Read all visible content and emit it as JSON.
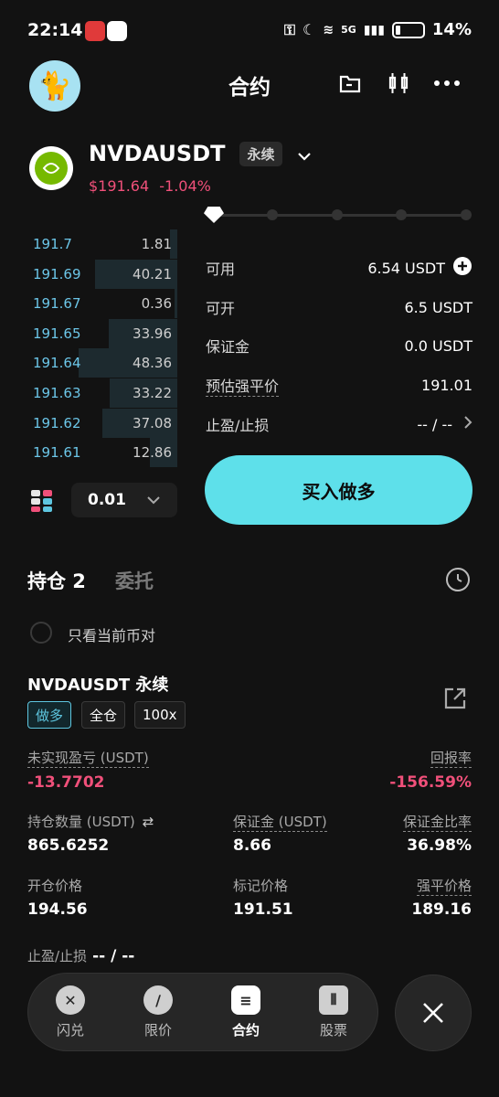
{
  "status_bar": {
    "time": "22:14",
    "battery": "14%",
    "network": "5G"
  },
  "header": {
    "title": "合约"
  },
  "symbol": {
    "name": "NVDAUSDT",
    "tag": "永续",
    "price": "$191.64",
    "change": "-1.04%"
  },
  "orderbook": {
    "rows": [
      {
        "price": "191.7",
        "amount": "1.81",
        "depth": 0.05
      },
      {
        "price": "191.69",
        "amount": "40.21",
        "depth": 0.55
      },
      {
        "price": "191.67",
        "amount": "0.36",
        "depth": 0.02
      },
      {
        "price": "191.65",
        "amount": "33.96",
        "depth": 0.46
      },
      {
        "price": "191.64",
        "amount": "48.36",
        "depth": 0.66
      },
      {
        "price": "191.63",
        "amount": "33.22",
        "depth": 0.45
      },
      {
        "price": "191.62",
        "amount": "37.08",
        "depth": 0.5
      },
      {
        "price": "191.61",
        "amount": "12.86",
        "depth": 0.18
      }
    ],
    "precision": "0.01"
  },
  "form": {
    "available_label": "可用",
    "available_value": "6.54 USDT",
    "openable_label": "可开",
    "openable_value": "6.5 USDT",
    "margin_label": "保证金",
    "margin_value": "0.0 USDT",
    "liq_label": "预估强平价",
    "liq_value": "191.01",
    "tpsl_label": "止盈/止损",
    "tpsl_value": "-- / --",
    "buy_label": "买入做多",
    "slider_level": 0
  },
  "tabs": {
    "positions": "持仓 2",
    "orders": "委托"
  },
  "filter": {
    "label": "只看当前币对"
  },
  "position": {
    "title": "NVDAUSDT 永续",
    "side": "做多",
    "mode": "全仓",
    "leverage": "100x",
    "upnl_label": "未实现盈亏 (USDT)",
    "upnl_value": "-13.7702",
    "roe_label": "回报率",
    "roe_value": "-156.59%",
    "size_label": "持仓数量 (USDT)",
    "size_value": "865.6252",
    "margin_label": "保证金 (USDT)",
    "margin_value": "8.66",
    "margin_ratio_label": "保证金比率",
    "margin_ratio_value": "36.98%",
    "entry_label": "开仓价格",
    "entry_value": "194.56",
    "mark_label": "标记价格",
    "mark_value": "191.51",
    "liq_label": "强平价格",
    "liq_value": "189.16",
    "tpsl_label": "止盈/止损",
    "tpsl_value": "-- / --"
  },
  "nav": {
    "items": [
      {
        "label": "闪兑",
        "icon": "swap-icon"
      },
      {
        "label": "限价",
        "icon": "limit-icon"
      },
      {
        "label": "合约",
        "icon": "contract-icon"
      },
      {
        "label": "股票",
        "icon": "stock-icon"
      }
    ]
  },
  "colors": {
    "accent": "#5ee0ea",
    "down": "#f0507a",
    "price_blue": "#6cc6e8",
    "background": "#121212"
  }
}
